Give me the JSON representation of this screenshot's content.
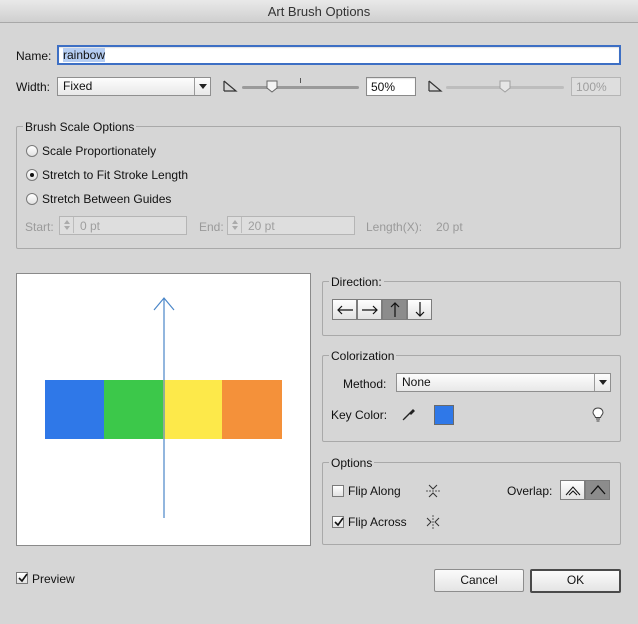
{
  "window": {
    "title": "Art Brush Options"
  },
  "name_field": {
    "label": "Name:",
    "value": "rainbow"
  },
  "width": {
    "label": "Width:",
    "selected": "Fixed",
    "slider1_value": "50%",
    "slider2_value": "100%"
  },
  "brush_scale": {
    "title": "Brush Scale Options",
    "options": [
      {
        "label": "Scale Proportionately",
        "selected": false
      },
      {
        "label": "Stretch to Fit Stroke Length",
        "selected": true
      },
      {
        "label": "Stretch Between Guides",
        "selected": false
      }
    ],
    "start_label": "Start:",
    "start_value": "0 pt",
    "end_label": "End:",
    "end_value": "20 pt",
    "length_label": "Length(X):",
    "length_value": "20 pt"
  },
  "preview_art": {
    "colors": [
      "#2f78e8",
      "#3cc84a",
      "#fde94a",
      "#f4913a"
    ],
    "arrow_color": "#4a86c8"
  },
  "direction": {
    "title": "Direction:",
    "buttons": [
      {
        "icon": "arrow-left-icon",
        "active": false
      },
      {
        "icon": "arrow-right-icon",
        "active": false
      },
      {
        "icon": "arrow-up-icon",
        "active": true
      },
      {
        "icon": "arrow-down-icon",
        "active": false
      }
    ]
  },
  "colorization": {
    "title": "Colorization",
    "method_label": "Method:",
    "method_value": "None",
    "key_color_label": "Key Color:",
    "key_color": "#2f78e8"
  },
  "options": {
    "title": "Options",
    "flip_along_label": "Flip Along",
    "flip_along_checked": false,
    "flip_across_label": "Flip Across",
    "flip_across_checked": true,
    "overlap_label": "Overlap:"
  },
  "footer": {
    "preview_label": "Preview",
    "preview_checked": true,
    "cancel_label": "Cancel",
    "ok_label": "OK"
  }
}
